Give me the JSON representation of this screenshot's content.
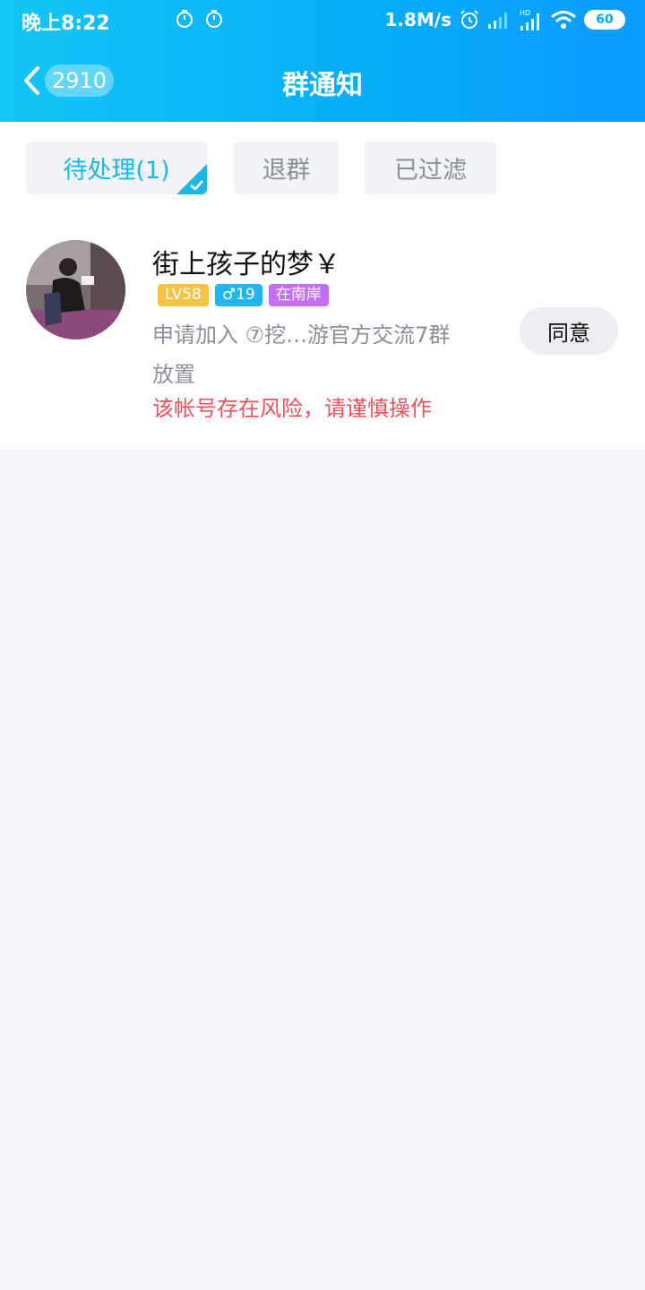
{
  "status_bar": {
    "time": "晚上8:22",
    "net_speed": "1.8M/s",
    "battery": "60",
    "icons": [
      "timer-icon",
      "timer-icon",
      "alarm-icon",
      "signal-icon",
      "hd-signal-icon",
      "wifi-icon",
      "battery-icon"
    ]
  },
  "header": {
    "back_count": "2910",
    "title": "群通知",
    "gradient": [
      "#12c6f5",
      "#0a9bff"
    ]
  },
  "tabs": [
    {
      "label": "待处理(1)",
      "active": true
    },
    {
      "label": "退群",
      "active": false
    },
    {
      "label": "已过滤",
      "active": false
    }
  ],
  "request": {
    "name": "街上孩子的梦￥",
    "badges": [
      {
        "text": "LV58",
        "color": "#f6c445"
      },
      {
        "text": "♂19",
        "color": "#22b5f0"
      },
      {
        "text": "在南岸",
        "color": "#c36ef3"
      }
    ],
    "request_text": "申请加入 ⑦挖…游官方交流7群",
    "request_text_2": "放置",
    "warning": "该帐号存在风险，请谨慎操作",
    "agree_label": "同意"
  },
  "colors": {
    "accent": "#19b8e8",
    "warning": "#f04f5c",
    "background": "#f3f5f8"
  }
}
